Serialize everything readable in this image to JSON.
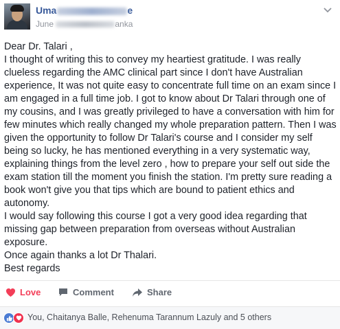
{
  "post": {
    "author_visible": "Uma",
    "author_suffix": "e",
    "date_prefix": "June",
    "location_suffix": "anka",
    "greeting": "Dear Dr. Talari ,",
    "paragraph1": "I thought of writing this to convey my heartiest gratitude. I was really clueless regarding the AMC clinical part since I don't have Australian experience, It was not quite easy to concentrate full time on an exam since I am engaged in a full time job. I got to know about Dr Talari through one of my cousins, and I was greatly privileged to have a conversation with him for few minutes which really changed my whole preparation pattern. Then I was given the opportunity to follow Dr Talari's course and I consider my self being so lucky, he has mentioned everything in a very systematic way, explaining things from the level zero , how to prepare your self out side the exam station till the moment you finish the station. I'm pretty sure reading a book won't give you that tips which are bound to patient ethics and autonomy.",
    "paragraph2": "I would say following this course I got a very good idea regarding that missing gap between preparation from overseas without Australian exposure.",
    "paragraph3": "Once again thanks a lot Dr Thalari.",
    "signoff": "Best regards"
  },
  "actions": {
    "love_label": "Love",
    "comment_label": "Comment",
    "share_label": "Share"
  },
  "reactions": {
    "summary": "You, Chaitanya Balle, Rehenuma Tarannum Lazuly and 5 others"
  },
  "icons": {
    "menu": "chevron-down-icon",
    "love": "heart-icon",
    "comment": "comment-icon",
    "share": "share-arrow-icon",
    "like_reaction": "thumbs-up-icon",
    "love_reaction": "heart-icon"
  },
  "colors": {
    "author": "#365899",
    "love": "#f33e58",
    "action_text": "#616770",
    "like_badge": "#4a7bd3",
    "love_badge": "#f0324f"
  }
}
